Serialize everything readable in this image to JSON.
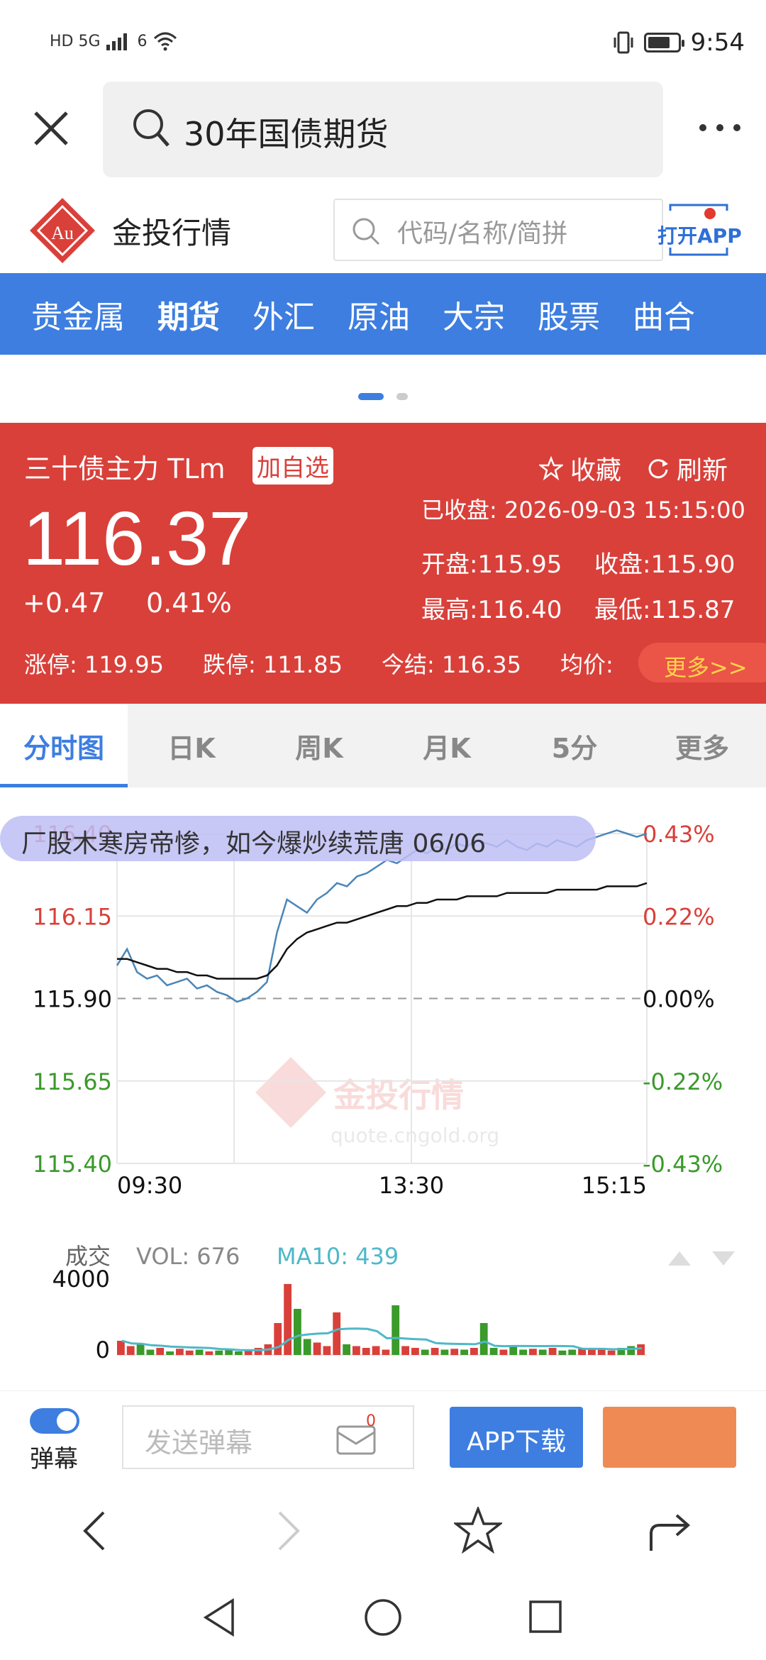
{
  "status_bar": {
    "network": "HD 5G",
    "wifi": "6",
    "time": "9:54"
  },
  "browser": {
    "query": "30年国债期货"
  },
  "site": {
    "name": "金投行情",
    "logo_text": "Au",
    "search_placeholder": "代码/名称/简拼",
    "open_app": "打开APP"
  },
  "nav": {
    "items": [
      "贵金属",
      "期货",
      "外汇",
      "原油",
      "大宗",
      "股票",
      "曲合"
    ],
    "active_index": 1
  },
  "quote": {
    "name": "三十债主力 TLm",
    "add_watch": "加自选",
    "favorite": "收藏",
    "refresh": "刷新",
    "price": "116.37",
    "change": "+0.47",
    "change_pct": "0.41%",
    "status": "已收盘: 2026-09-03 15:15:00",
    "open": "开盘:115.95",
    "prev_close": "收盘:115.90",
    "high": "最高:116.40",
    "low": "最低:115.87",
    "limit_up": "涨停: 119.95",
    "limit_down": "跌停: 111.85",
    "settle": "今结: 116.35",
    "avg": "均价:",
    "more": "更多>>"
  },
  "tabs": {
    "items": [
      "分时图",
      "日K",
      "周K",
      "月K",
      "5分",
      "更多"
    ],
    "active_index": 0
  },
  "ticker": {
    "text": "厂股木寒房帝惨，如今爆炒续荒唐   06/06"
  },
  "watermark": {
    "name": "金投行情",
    "url": "quote.cngold.org"
  },
  "colors": {
    "up": "#d9403a",
    "down": "#3a9a2a",
    "accent": "#3d7ee0",
    "price_line": "#4a86b8",
    "avg_line": "#111111",
    "ma_line": "#4fb8c8"
  },
  "chart_data": {
    "type": "line",
    "x_ticks": [
      "09:30",
      "13:30",
      "15:15"
    ],
    "y_left_ticks": [
      "116.40",
      "116.15",
      "115.90",
      "115.65",
      "115.40"
    ],
    "y_right_ticks": [
      "0.43%",
      "0.22%",
      "0.00%",
      "-0.22%",
      "-0.43%"
    ],
    "ylim": [
      115.4,
      116.4
    ],
    "prev_close": 115.9,
    "series": [
      {
        "values": [
          116.0,
          116.05,
          115.98,
          115.96,
          115.97,
          115.94,
          115.95,
          115.96,
          115.93,
          115.94,
          115.92,
          115.91,
          115.89,
          115.9,
          115.92,
          115.95,
          116.1,
          116.2,
          116.18,
          116.16,
          116.2,
          116.22,
          116.25,
          116.24,
          116.27,
          116.28,
          116.3,
          116.32,
          116.31,
          116.33,
          116.35,
          116.34,
          116.36,
          116.35,
          116.37,
          116.36,
          116.38,
          116.37,
          116.36,
          116.38,
          116.36,
          116.35,
          116.37,
          116.36,
          116.38,
          116.37,
          116.36,
          116.38,
          116.39,
          116.4,
          116.41,
          116.4,
          116.39,
          116.4
        ]
      },
      {
        "values": [
          116.02,
          116.02,
          116.01,
          116.0,
          115.99,
          115.99,
          115.98,
          115.98,
          115.97,
          115.97,
          115.96,
          115.96,
          115.96,
          115.96,
          115.96,
          115.97,
          116.0,
          116.05,
          116.08,
          116.1,
          116.11,
          116.12,
          116.13,
          116.13,
          116.14,
          116.15,
          116.16,
          116.17,
          116.18,
          116.18,
          116.19,
          116.19,
          116.2,
          116.2,
          116.2,
          116.21,
          116.21,
          116.21,
          116.21,
          116.22,
          116.22,
          116.22,
          116.22,
          116.22,
          116.23,
          116.23,
          116.23,
          116.23,
          116.23,
          116.24,
          116.24,
          116.24,
          116.24,
          116.25
        ]
      }
    ],
    "volume": {
      "label": "成交",
      "vol_label": "VOL: 676",
      "ma_label": "MA10: 439",
      "y_ticks": [
        "4000",
        "0"
      ],
      "values": [
        800,
        500,
        600,
        300,
        400,
        200,
        350,
        250,
        300,
        200,
        250,
        300,
        200,
        250,
        400,
        600,
        1800,
        4300,
        2600,
        900,
        700,
        500,
        2400,
        600,
        500,
        400,
        500,
        300,
        2800,
        500,
        400,
        300,
        400,
        300,
        350,
        300,
        400,
        1800,
        400,
        300,
        500,
        300,
        350,
        300,
        400,
        250,
        300,
        350,
        400,
        300,
        250,
        400,
        500,
        600
      ]
    }
  },
  "comment_bar": {
    "danmu_label": "弹幕",
    "placeholder": "发送弹幕",
    "badge": "0",
    "app_download": "APP下载"
  }
}
